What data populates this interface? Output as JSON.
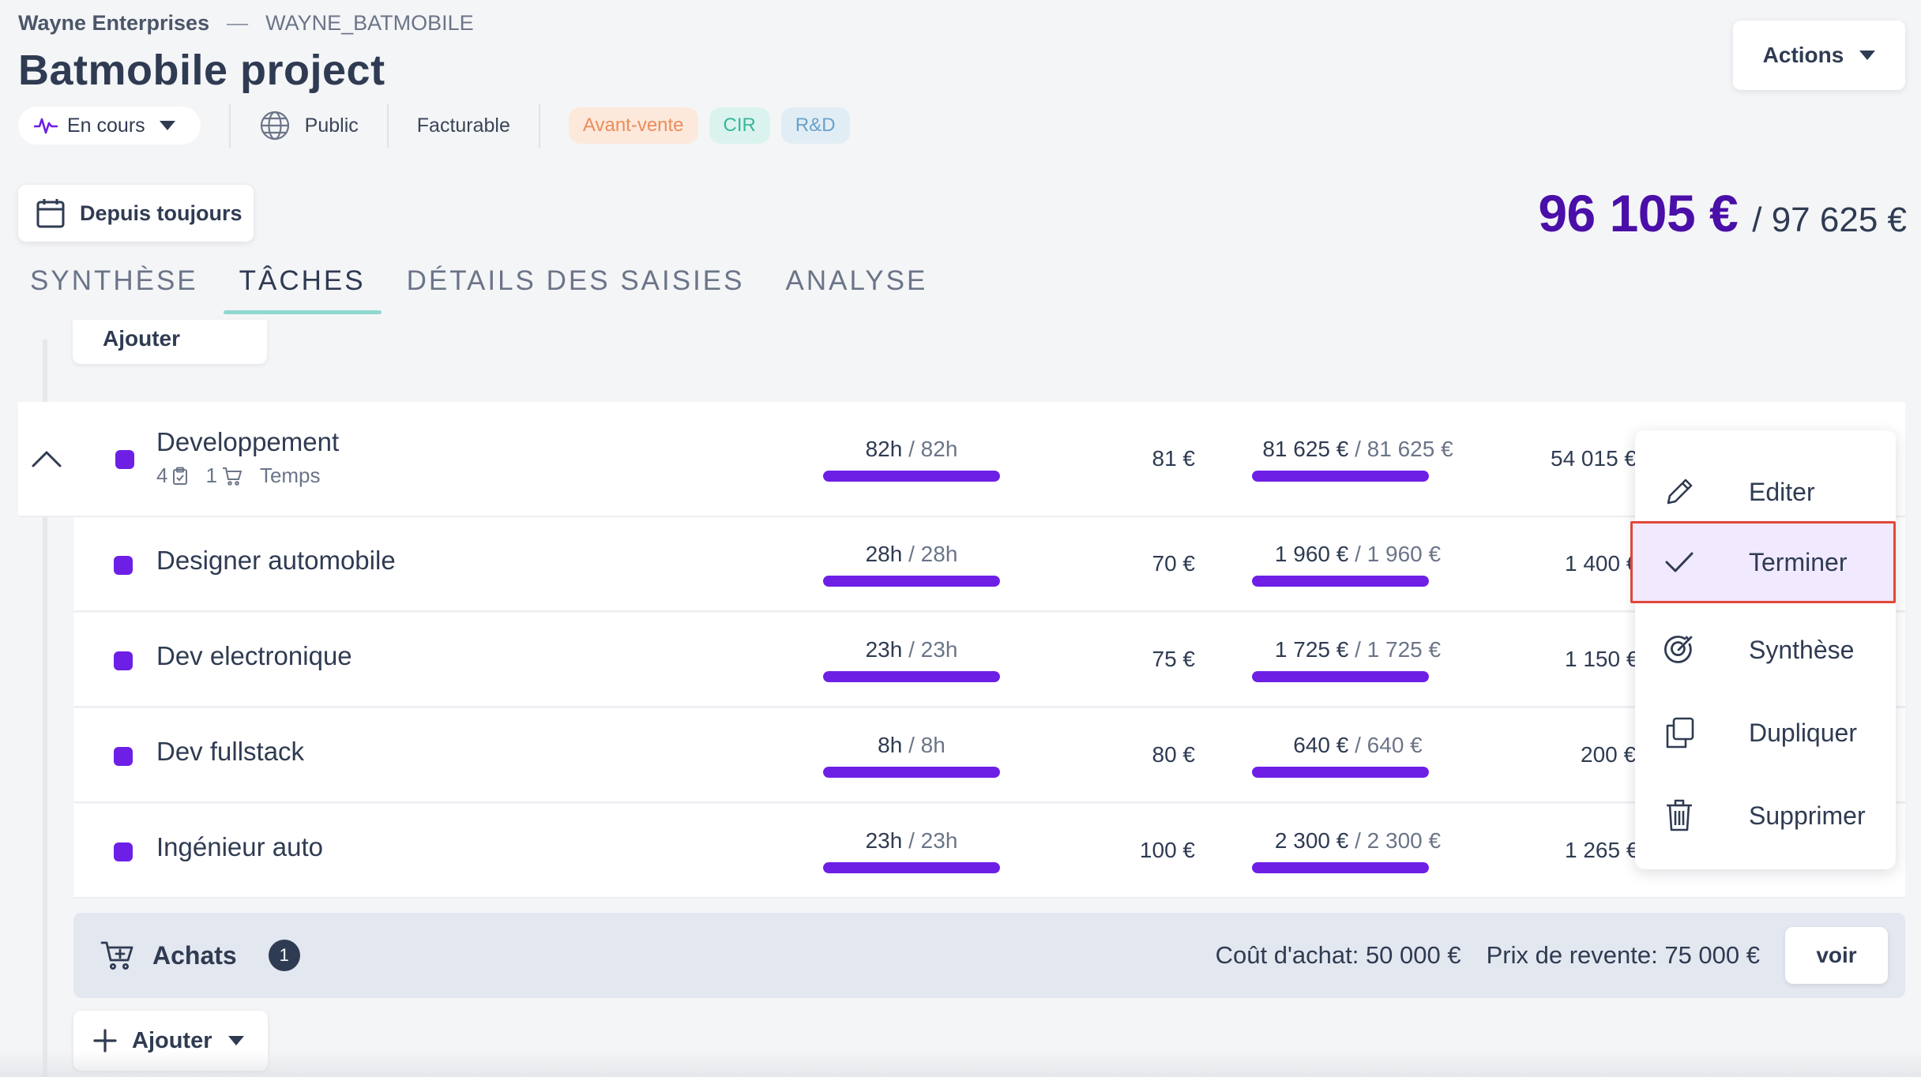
{
  "breadcrumb": {
    "company": "Wayne Enterprises",
    "separator": "—",
    "code": "WAYNE_BATMOBILE"
  },
  "project": {
    "title": "Batmobile project"
  },
  "meta": {
    "status": "En cours",
    "visibility": "Public",
    "billing": "Facturable",
    "tags": [
      {
        "label": "Avant-vente",
        "color": "#ec8c5a"
      },
      {
        "label": "CIR",
        "color": "#38b6a0"
      },
      {
        "label": "R&D",
        "color": "#6aa1c8"
      }
    ]
  },
  "header": {
    "actions_label": "Actions"
  },
  "period": {
    "label": "Depuis toujours"
  },
  "budget": {
    "spent": "96 105 €",
    "total": "/ 97 625 €"
  },
  "tabs": [
    {
      "label": "SYNTHÈSE",
      "active": false
    },
    {
      "label": "TÂCHES",
      "active": true
    },
    {
      "label": "DÉTAILS DES SAISIES",
      "active": false
    },
    {
      "label": "ANALYSE",
      "active": false
    }
  ],
  "add_button": {
    "label": "Ajouter"
  },
  "group": {
    "name": "Developpement",
    "tasks_count": "4",
    "purchases_count": "1",
    "type": "Temps",
    "hours_done": "82h",
    "hours_total": "/ 82h",
    "hours_progress": 1.0,
    "rate": "81 €",
    "cost_done": "81 625 €",
    "cost_total": "/ 81 625 €",
    "cost_progress": 1.0,
    "margin": "54 015 €"
  },
  "tasks": [
    {
      "name": "Designer automobile",
      "hours_done": "28h",
      "hours_total": "/ 28h",
      "hours_progress": 1.0,
      "rate": "70 €",
      "cost_done": "1 960 €",
      "cost_total": "/ 1 960 €",
      "cost_progress": 1.0,
      "margin": "1 400 €"
    },
    {
      "name": "Dev electronique",
      "hours_done": "23h",
      "hours_total": "/ 23h",
      "hours_progress": 1.0,
      "rate": "75 €",
      "cost_done": "1 725 €",
      "cost_total": "/ 1 725 €",
      "cost_progress": 1.0,
      "margin": "1 150 €"
    },
    {
      "name": "Dev fullstack",
      "hours_done": "8h",
      "hours_total": "/ 8h",
      "hours_progress": 1.0,
      "rate": "80 €",
      "cost_done": "640 €",
      "cost_total": "/ 640 €",
      "cost_progress": 1.0,
      "margin": "200 €"
    },
    {
      "name": "Ingénieur auto",
      "hours_done": "23h",
      "hours_total": "/ 23h",
      "hours_progress": 1.0,
      "rate": "100 €",
      "cost_done": "2 300 €",
      "cost_total": "/ 2 300 €",
      "cost_progress": 1.0,
      "margin": "1 265 €"
    }
  ],
  "achats": {
    "label": "Achats",
    "count": "1",
    "purchase_cost": "Coût d'achat: 50 000 €",
    "resale_price": "Prix de revente: 75 000 €",
    "view_label": "voir"
  },
  "context_menu": {
    "items": [
      {
        "label": "Editer",
        "icon": "pencil-icon"
      },
      {
        "label": "Terminer",
        "icon": "check-icon",
        "highlighted": true
      },
      {
        "label": "Synthèse",
        "icon": "target-icon"
      },
      {
        "label": "Dupliquer",
        "icon": "copy-icon"
      },
      {
        "label": "Supprimer",
        "icon": "trash-icon"
      }
    ]
  },
  "colors": {
    "accent": "#6d1fe6",
    "amount": "#4a0fa8",
    "highlight_border": "#e0483a",
    "tab_underline": "#8fd8cf"
  }
}
